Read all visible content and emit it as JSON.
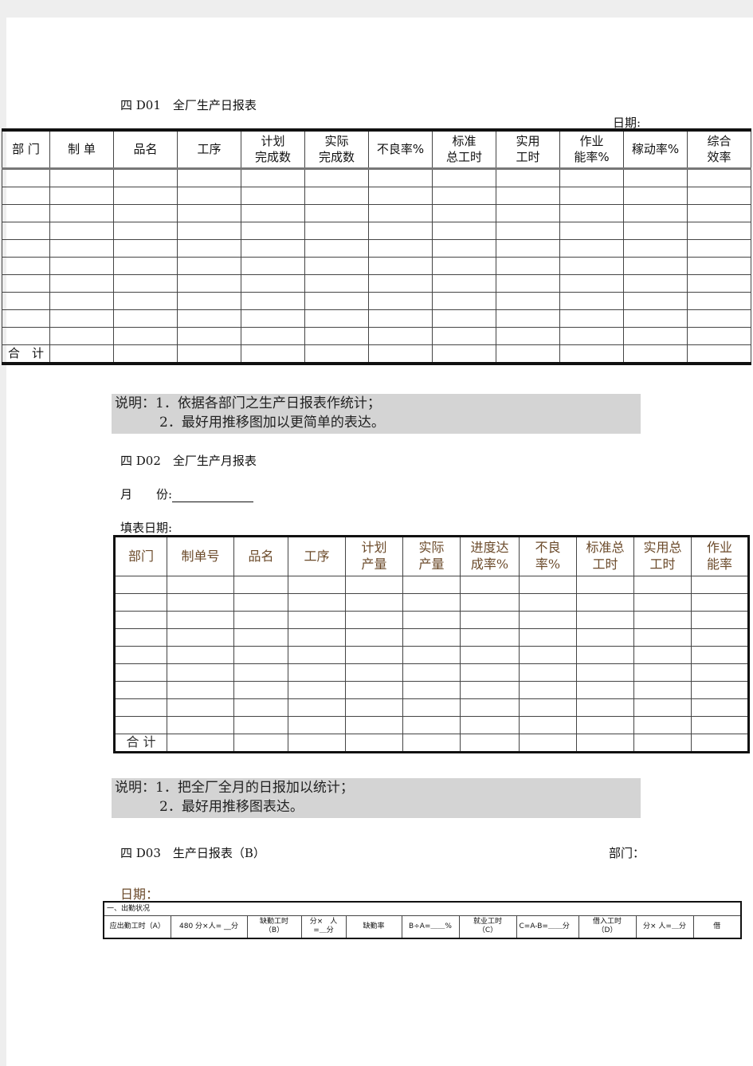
{
  "d01": {
    "title": "四 D01　全厂生产日报表",
    "date_label": "日期:",
    "headers": [
      "部 门",
      "制 单",
      "品名",
      "工序",
      "计划\n完成数",
      "实际\n完成数",
      "不良率%",
      "标准\n总工时",
      "实用\n工时",
      "作业\n能率%",
      "稼动率%",
      "综合\n效率"
    ],
    "blank_rows": 10,
    "total_label": "合　计"
  },
  "note1": {
    "line1": "说明：1．依据各部门之生产日报表作统计；",
    "line2": "2．最好用推移图加以更简单的表达。"
  },
  "d02": {
    "title": "四 D02　全厂生产月报表",
    "month_label": "月　　份:",
    "fill_date_label": "填表日期:",
    "headers": [
      "部门",
      "制单号",
      "品名",
      "工序",
      "计划\n产量",
      "实际\n产量",
      "进度达\n成率%",
      "不良\n率%",
      "标准总\n工时",
      "实用总\n工时",
      "作业\n能率"
    ],
    "blank_rows": 9,
    "total_label": "合 计"
  },
  "note2": {
    "line1": "说明：1．把全厂全月的日报加以统计；",
    "line2": "2．最好用推移图表达。"
  },
  "d03": {
    "title": "四 D03　生产日报表（B）",
    "dept_label": "部门：",
    "date_label": "日期：",
    "section": "一、出勤状况",
    "cells": [
      "应出勤工时（A）",
      "480 分×人= __分",
      "缺勤工时\n（B）",
      "分×　人\n=＿分",
      "缺勤率",
      "B÷A=＿＿%",
      "就业工时\n（C）",
      "C=A-B=＿＿分",
      "借入工时\n（D）",
      "分× 人=＿分",
      "借"
    ]
  }
}
